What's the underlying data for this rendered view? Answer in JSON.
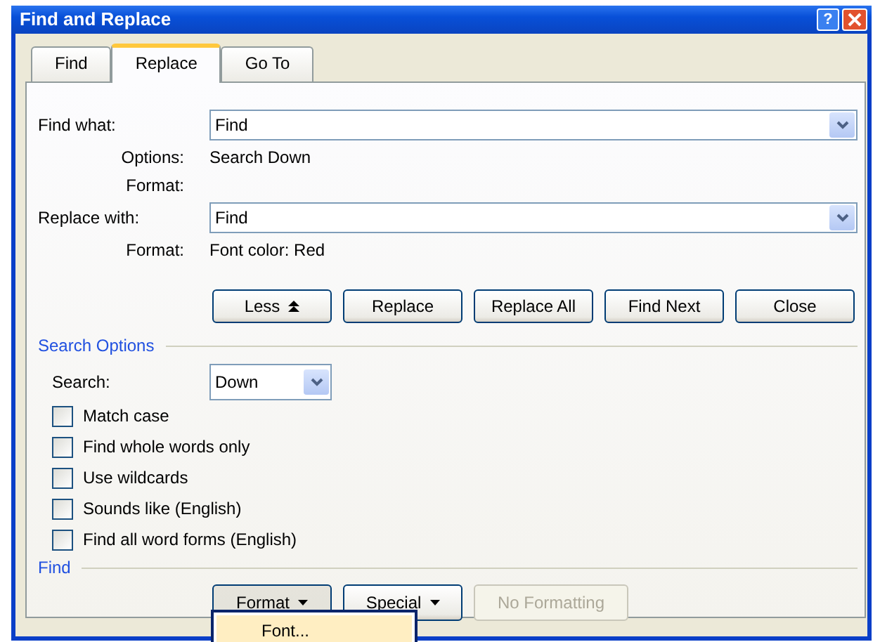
{
  "window": {
    "title": "Find and Replace",
    "help_button": "?"
  },
  "tabs": [
    {
      "label": "Find",
      "selected": false
    },
    {
      "label": "Replace",
      "selected": true
    },
    {
      "label": "Go To",
      "selected": false
    }
  ],
  "find_what": {
    "label": "Find what:",
    "value": "Find"
  },
  "find_details": [
    {
      "label": "Options:",
      "value": "Search Down"
    },
    {
      "label": "Format:"
    }
  ],
  "replace_with": {
    "label": "Replace with:",
    "value": "Find"
  },
  "replace_details": [
    {
      "label": "Format:",
      "value": "Font color: Red"
    }
  ],
  "buttons": [
    {
      "label": "Less",
      "kind": "collapse"
    },
    {
      "label": "Replace",
      "kind": "plain"
    },
    {
      "label": "Replace All",
      "kind": "plain"
    },
    {
      "label": "Find Next",
      "kind": "plain"
    },
    {
      "label": "Close",
      "kind": "plain"
    }
  ],
  "search_options": {
    "heading": "Search Options",
    "search": {
      "label": "Search:",
      "value": "Down"
    },
    "checkboxes": [
      {
        "label": "Match case",
        "checked": false
      },
      {
        "label": "Find whole words only",
        "checked": false
      },
      {
        "label": "Use wildcards",
        "checked": false
      },
      {
        "label": "Sounds like (English)",
        "checked": false
      },
      {
        "label": "Find all word forms (English)",
        "checked": false
      }
    ]
  },
  "find_section": {
    "heading": "Find",
    "buttons": [
      {
        "label": "Format",
        "dropdown": true,
        "pressed": true,
        "disabled": false
      },
      {
        "label": "Special",
        "dropdown": true,
        "pressed": false,
        "disabled": false
      },
      {
        "label": "No Formatting",
        "dropdown": false,
        "pressed": false,
        "disabled": true
      }
    ]
  },
  "format_menu": {
    "items": [
      {
        "label": "Font...",
        "selected": true
      }
    ]
  }
}
